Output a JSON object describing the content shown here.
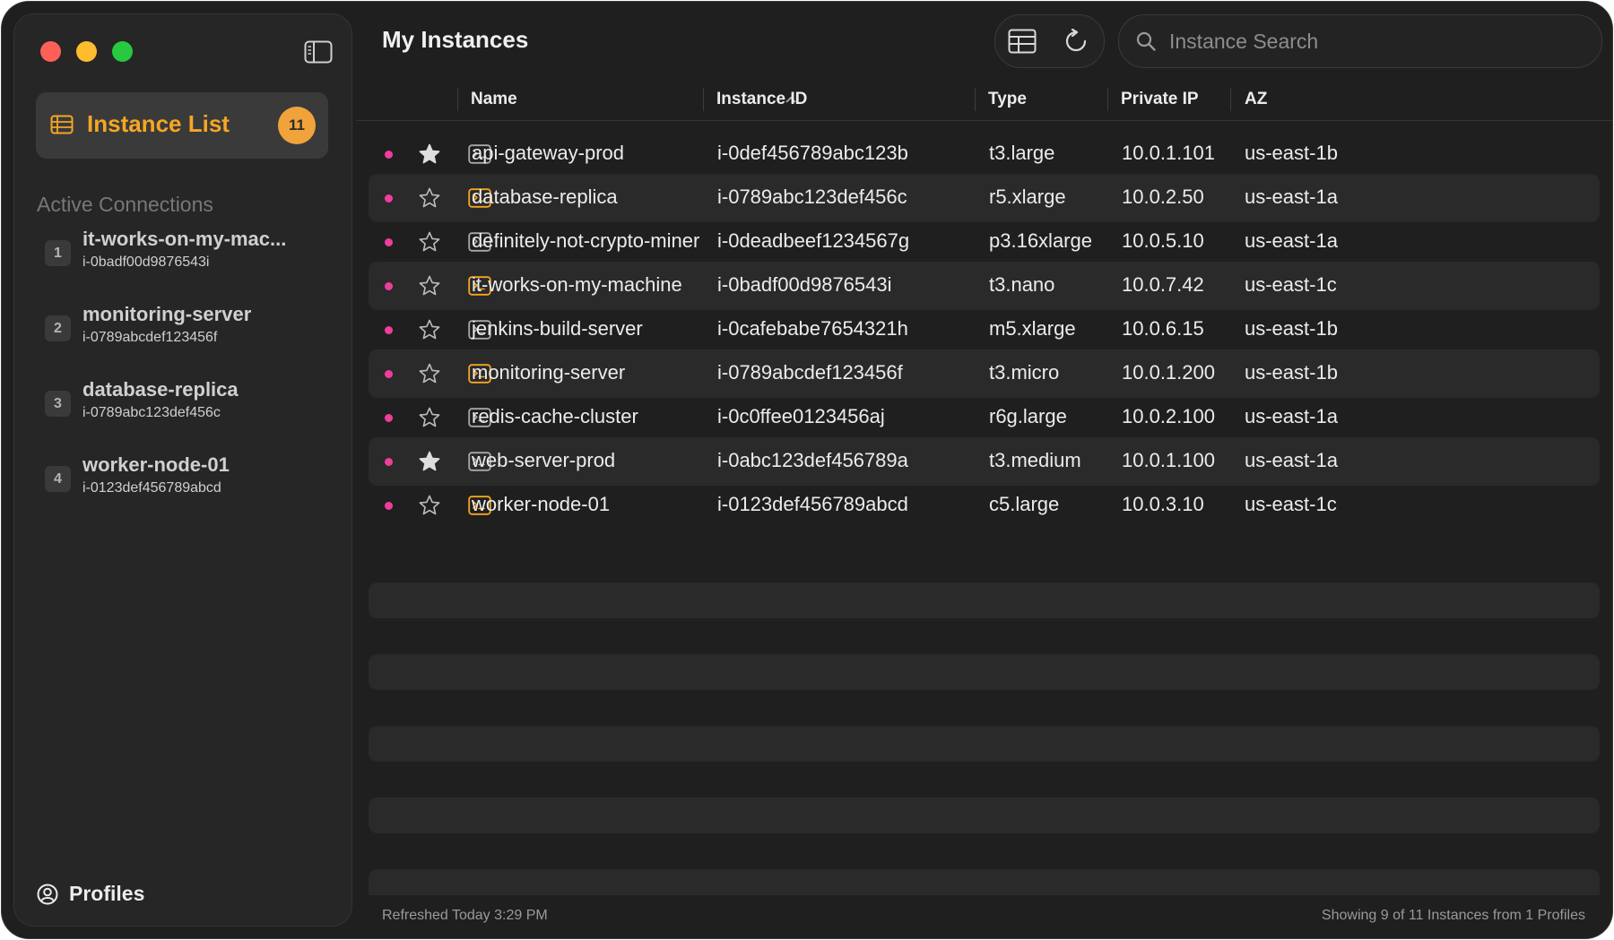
{
  "sidebar": {
    "nav_selected": {
      "label": "Instance List",
      "badge": "11"
    },
    "section_title": "Active Connections",
    "connections": [
      {
        "num": "1",
        "name": "it-works-on-my-mac...",
        "id": "i-0badf00d9876543i"
      },
      {
        "num": "2",
        "name": "monitoring-server",
        "id": "i-0789abcdef123456f"
      },
      {
        "num": "3",
        "name": "database-replica",
        "id": "i-0789abc123def456c"
      },
      {
        "num": "4",
        "name": "worker-node-01",
        "id": "i-0123def456789abcd"
      }
    ],
    "profiles_label": "Profiles"
  },
  "header": {
    "title": "My Instances",
    "search_placeholder": "Instance Search"
  },
  "table": {
    "columns": [
      "Name",
      "Instance ID",
      "Type",
      "Private IP",
      "AZ"
    ],
    "rows": [
      {
        "starred": true,
        "term_active": false,
        "name": "api-gateway-prod",
        "instance_id": "i-0def456789abc123b",
        "type": "t3.large",
        "ip": "10.0.1.101",
        "az": "us-east-1b"
      },
      {
        "starred": false,
        "term_active": true,
        "name": "database-replica",
        "instance_id": "i-0789abc123def456c",
        "type": "r5.xlarge",
        "ip": "10.0.2.50",
        "az": "us-east-1a"
      },
      {
        "starred": false,
        "term_active": false,
        "name": "definitely-not-crypto-miner",
        "instance_id": "i-0deadbeef1234567g",
        "type": "p3.16xlarge",
        "ip": "10.0.5.10",
        "az": "us-east-1a"
      },
      {
        "starred": false,
        "term_active": true,
        "name": "it-works-on-my-machine",
        "instance_id": "i-0badf00d9876543i",
        "type": "t3.nano",
        "ip": "10.0.7.42",
        "az": "us-east-1c"
      },
      {
        "starred": false,
        "term_active": false,
        "name": "jenkins-build-server",
        "instance_id": "i-0cafebabe7654321h",
        "type": "m5.xlarge",
        "ip": "10.0.6.15",
        "az": "us-east-1b"
      },
      {
        "starred": false,
        "term_active": true,
        "name": "monitoring-server",
        "instance_id": "i-0789abcdef123456f",
        "type": "t3.micro",
        "ip": "10.0.1.200",
        "az": "us-east-1b"
      },
      {
        "starred": false,
        "term_active": false,
        "name": "redis-cache-cluster",
        "instance_id": "i-0c0ffee0123456aj",
        "type": "r6g.large",
        "ip": "10.0.2.100",
        "az": "us-east-1a"
      },
      {
        "starred": true,
        "term_active": false,
        "name": "web-server-prod",
        "instance_id": "i-0abc123def456789a",
        "type": "t3.medium",
        "ip": "10.0.1.100",
        "az": "us-east-1a"
      },
      {
        "starred": false,
        "term_active": true,
        "name": "worker-node-01",
        "instance_id": "i-0123def456789abcd",
        "type": "c5.large",
        "ip": "10.0.3.10",
        "az": "us-east-1c"
      }
    ]
  },
  "footer": {
    "left": "Refreshed Today 3:29 PM",
    "right": "Showing 9 of 11 Instances from 1 Profiles"
  },
  "colors": {
    "accent": "#f5a623",
    "status_dot": "#ef3e9c",
    "background": "#1f1f1f",
    "sidebar": "#262626"
  }
}
